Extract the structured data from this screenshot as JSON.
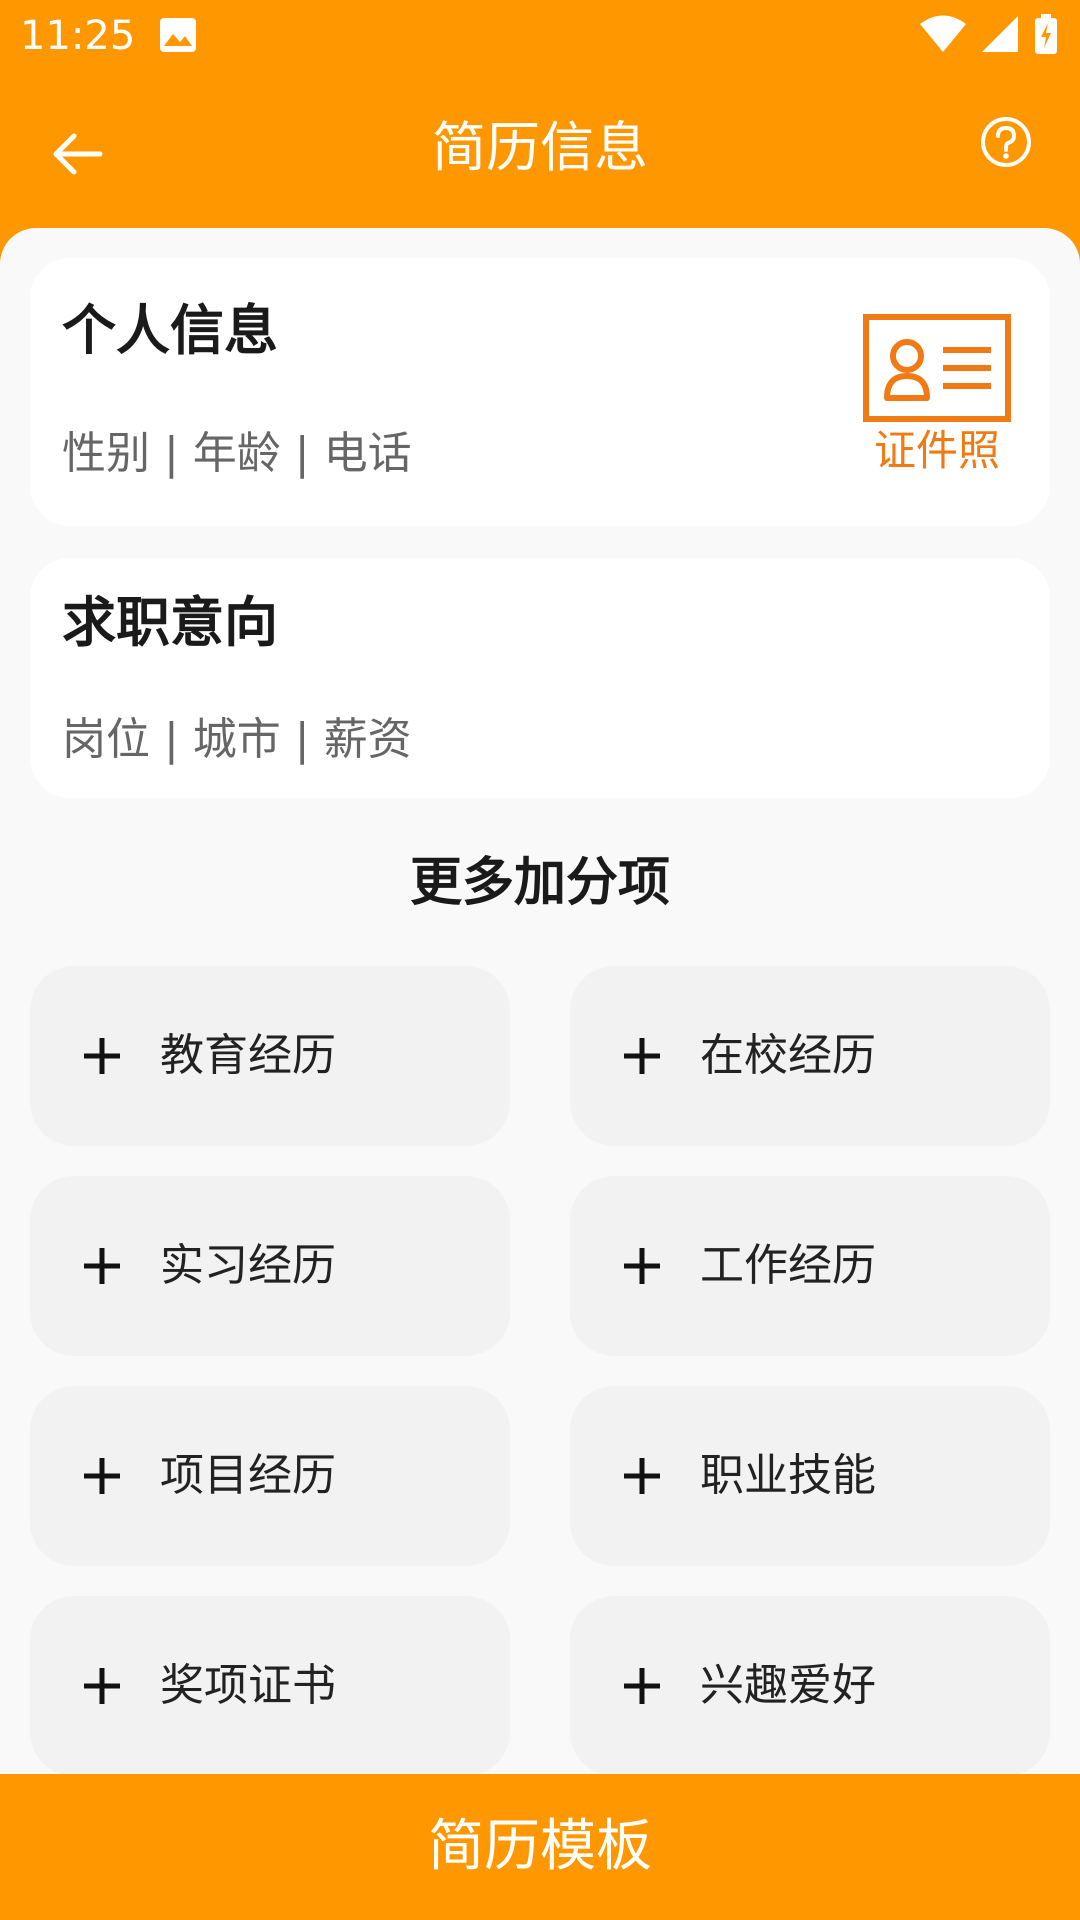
{
  "status_bar": {
    "time": "11:25",
    "icons": [
      "image-icon",
      "wifi-icon",
      "signal-icon",
      "battery-charging-icon"
    ]
  },
  "app_bar": {
    "title": "简历信息",
    "back_icon": "arrow-left-icon",
    "help_icon": "help-circle-icon"
  },
  "cards": {
    "personal": {
      "title": "个人信息",
      "subtitle": "性别 | 年龄 | 电话",
      "id_photo_label": "证件照"
    },
    "intent": {
      "title": "求职意向",
      "subtitle": "岗位 | 城市 | 薪资"
    }
  },
  "more": {
    "title": "更多加分项",
    "items": [
      {
        "label": "教育经历"
      },
      {
        "label": "在校经历"
      },
      {
        "label": "实习经历"
      },
      {
        "label": "工作经历"
      },
      {
        "label": "项目经历"
      },
      {
        "label": "职业技能"
      },
      {
        "label": "奖项证书"
      },
      {
        "label": "兴趣爱好"
      }
    ]
  },
  "bottom": {
    "button_label": "简历模板"
  },
  "colors": {
    "accent": "#ff9800",
    "id_photo": "#f07a13",
    "card_bg": "#ffffff",
    "item_bg": "#f2f2f2",
    "page_bg": "#f9f9f9"
  }
}
